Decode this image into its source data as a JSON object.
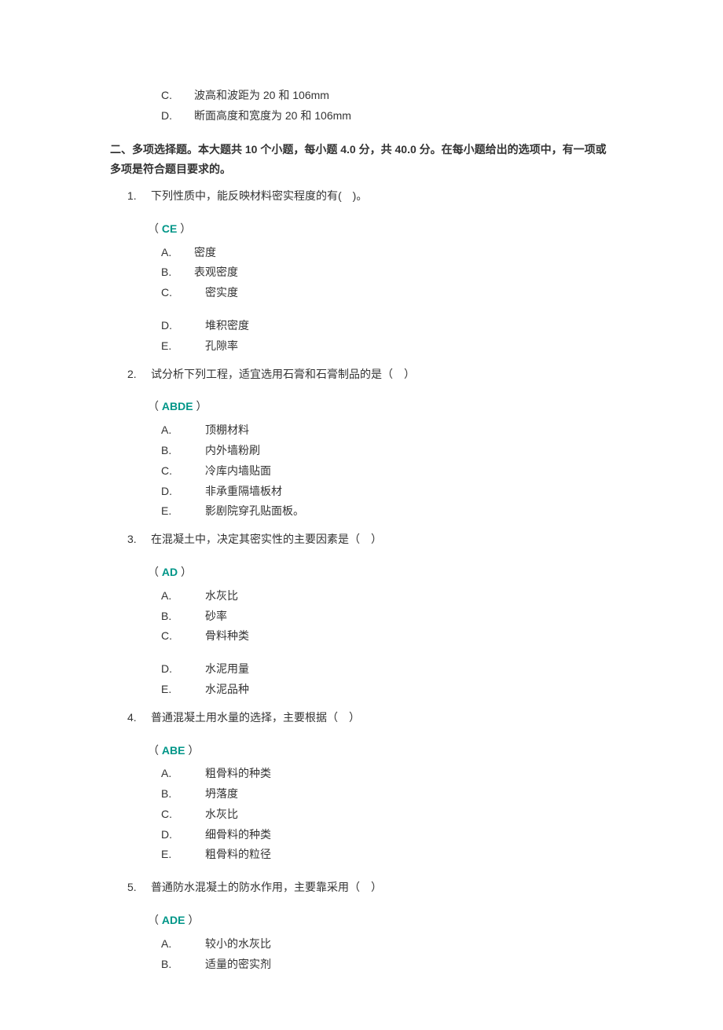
{
  "prelude": {
    "options": [
      {
        "letter": "C.",
        "text": "波高和波距为 20 和 106mm"
      },
      {
        "letter": "D.",
        "text": "断面高度和宽度为 20 和 106mm"
      }
    ]
  },
  "section2": {
    "header_prefix": "二、多项选择题。本大题共 ",
    "header_count": "10 ",
    "header_mid1": "个小题，每小题 ",
    "header_points": "4.0 ",
    "header_mid2": "分，共 ",
    "header_total": "40.0 ",
    "header_suffix": "分。在每小题给出的选项中，有一项或多项是符合题目要求的。",
    "questions": [
      {
        "num": "1.",
        "text": "下列性质中，能反映材料密实程度的有( )。",
        "answer": "CE",
        "options_a": [
          {
            "letter": "A.",
            "text": "密度"
          },
          {
            "letter": "B.",
            "text": "表观密度"
          },
          {
            "letter": "C.",
            "text": " 密实度"
          }
        ],
        "options_b": [
          {
            "letter": "D.",
            "text": " 堆积密度"
          },
          {
            "letter": "E.",
            "text": " 孔隙率"
          }
        ]
      },
      {
        "num": "2.",
        "text": "试分析下列工程，适宜选用石膏和石膏制品的是（ ）",
        "answer": "ABDE",
        "options_a": [
          {
            "letter": "A.",
            "text": " 顶棚材料"
          },
          {
            "letter": "B.",
            "text": " 内外墙粉刷"
          },
          {
            "letter": "C.",
            "text": " 冷库内墙贴面"
          },
          {
            "letter": "D.",
            "text": " 非承重隔墙板材"
          },
          {
            "letter": "E.",
            "text": " 影剧院穿孔贴面板。"
          }
        ],
        "options_b": []
      },
      {
        "num": "3.",
        "text": "在混凝土中，决定其密实性的主要因素是（ ）",
        "answer": "AD",
        "options_a": [
          {
            "letter": "A.",
            "text": " 水灰比"
          },
          {
            "letter": "B.",
            "text": " 砂率"
          },
          {
            "letter": "C.",
            "text": " 骨料种类"
          }
        ],
        "options_b": [
          {
            "letter": "D.",
            "text": " 水泥用量"
          },
          {
            "letter": "E.",
            "text": " 水泥品种"
          }
        ]
      },
      {
        "num": "4.",
        "text": "普通混凝土用水量的选择，主要根据（ ）",
        "answer": "ABE",
        "options_a": [
          {
            "letter": "A.",
            "text": " 粗骨料的种类"
          },
          {
            "letter": "B.",
            "text": " 坍落度"
          },
          {
            "letter": "C.",
            "text": " 水灰比"
          },
          {
            "letter": "D.",
            "text": " 细骨料的种类"
          },
          {
            "letter": "E.",
            "text": " 粗骨料的粒径"
          }
        ],
        "options_b": []
      },
      {
        "num": "5.",
        "text": "普通防水混凝土的防水作用，主要靠采用（ ）",
        "answer": "ADE",
        "options_a": [
          {
            "letter": "A.",
            "text": " 较小的水灰比"
          },
          {
            "letter": "B.",
            "text": " 适量的密实剂"
          }
        ],
        "options_b": []
      }
    ]
  }
}
